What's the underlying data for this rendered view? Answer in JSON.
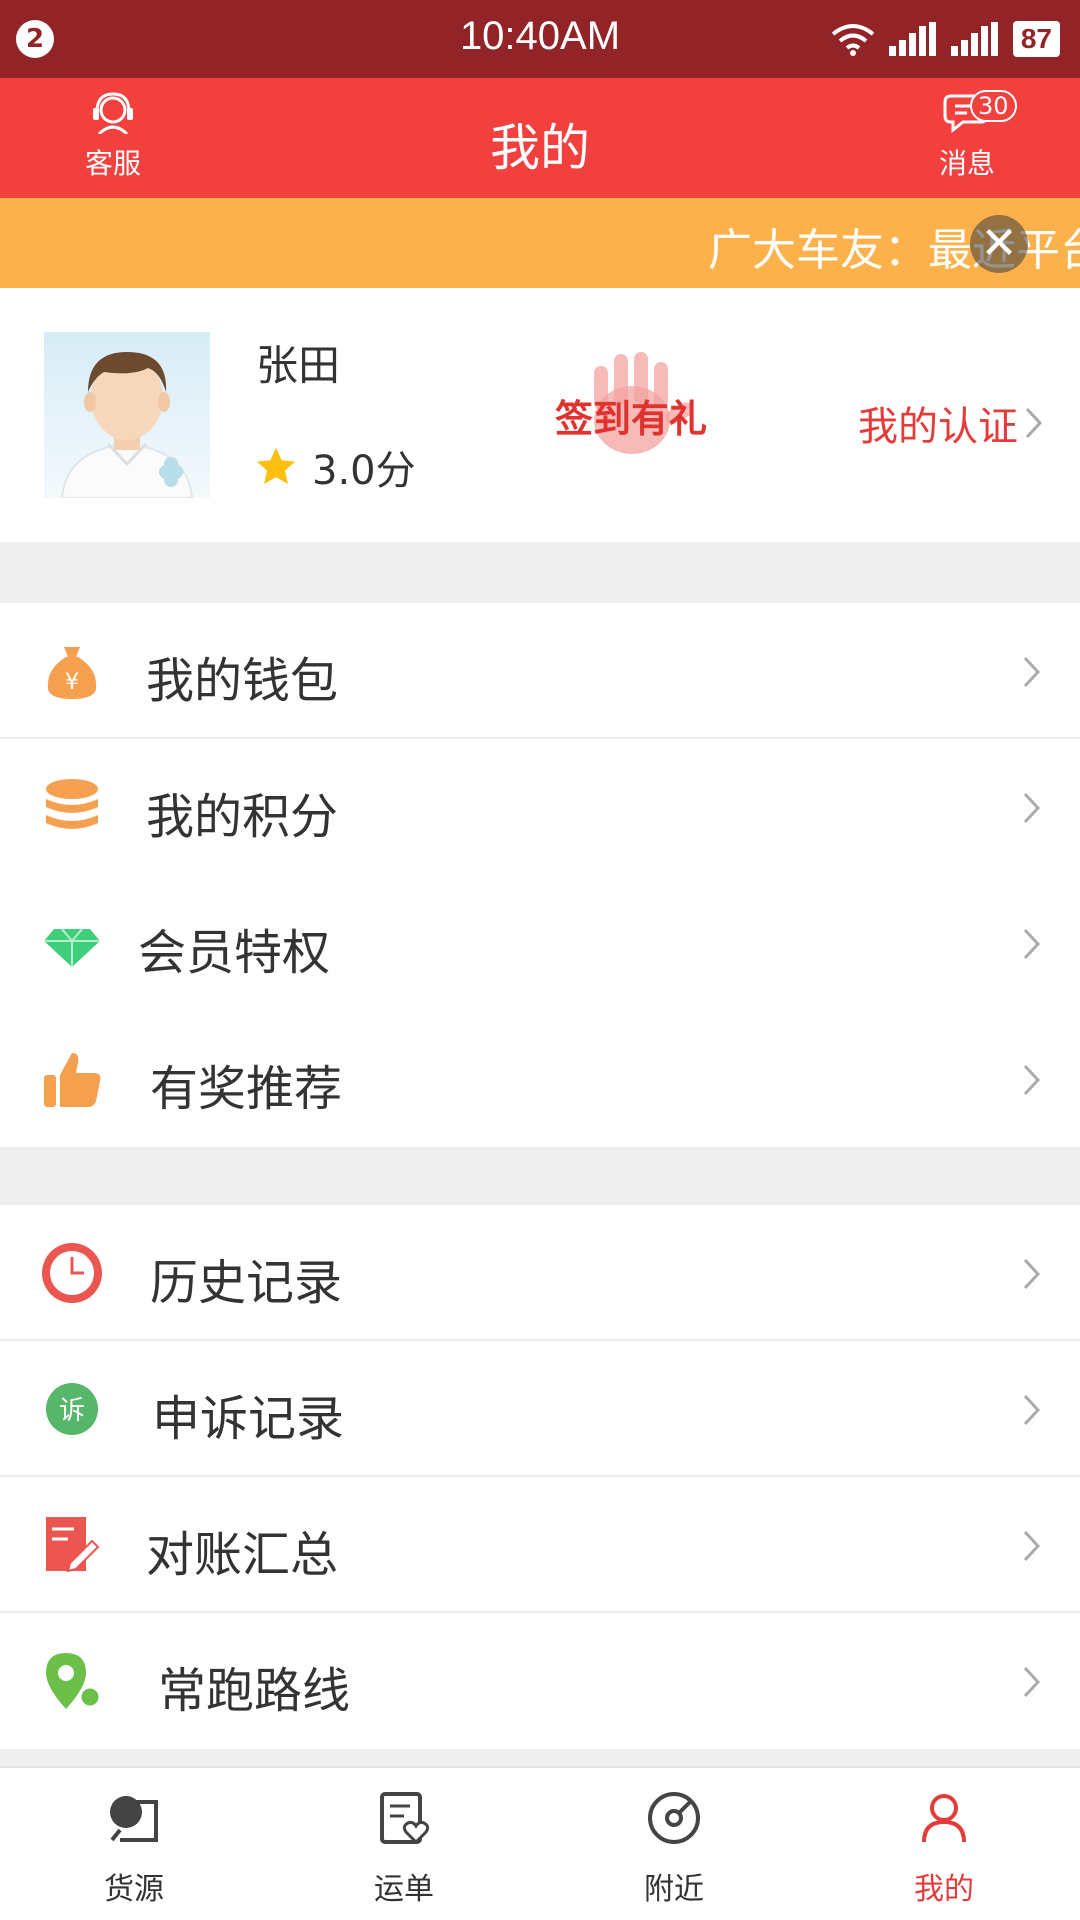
{
  "status_bar": {
    "notification_count": "2",
    "time": "10:40AM",
    "battery": "87"
  },
  "header": {
    "title": "我的",
    "service_label": "客服",
    "message_label": "消息",
    "message_badge": "30"
  },
  "notice": {
    "text": "广大车友：最近平台"
  },
  "profile": {
    "name": "张田",
    "rating": "3.0分",
    "signin_label": "签到有礼",
    "cert_label": "我的认证"
  },
  "menu_group_1": [
    {
      "label": "我的钱包",
      "icon": "money-bag-icon"
    },
    {
      "label": "我的积分",
      "icon": "coins-icon"
    },
    {
      "label": "会员特权",
      "icon": "diamond-icon"
    },
    {
      "label": "有奖推荐",
      "icon": "thumbs-up-icon"
    }
  ],
  "menu_group_2": [
    {
      "label": "历史记录",
      "icon": "clock-icon"
    },
    {
      "label": "申诉记录",
      "icon": "complaint-icon",
      "icon_text": "诉"
    },
    {
      "label": "对账汇总",
      "icon": "ledger-icon"
    },
    {
      "label": "常跑路线",
      "icon": "route-pin-icon"
    }
  ],
  "tabs": [
    {
      "label": "货源",
      "icon": "cargo-icon"
    },
    {
      "label": "运单",
      "icon": "waybill-icon"
    },
    {
      "label": "附近",
      "icon": "nearby-compass-icon"
    },
    {
      "label": "我的",
      "icon": "profile-icon",
      "active": true
    }
  ],
  "colors": {
    "status_bar": "#922427",
    "header": "#f2403e",
    "notice": "#fdb14b",
    "accent": "#e43c3a"
  }
}
